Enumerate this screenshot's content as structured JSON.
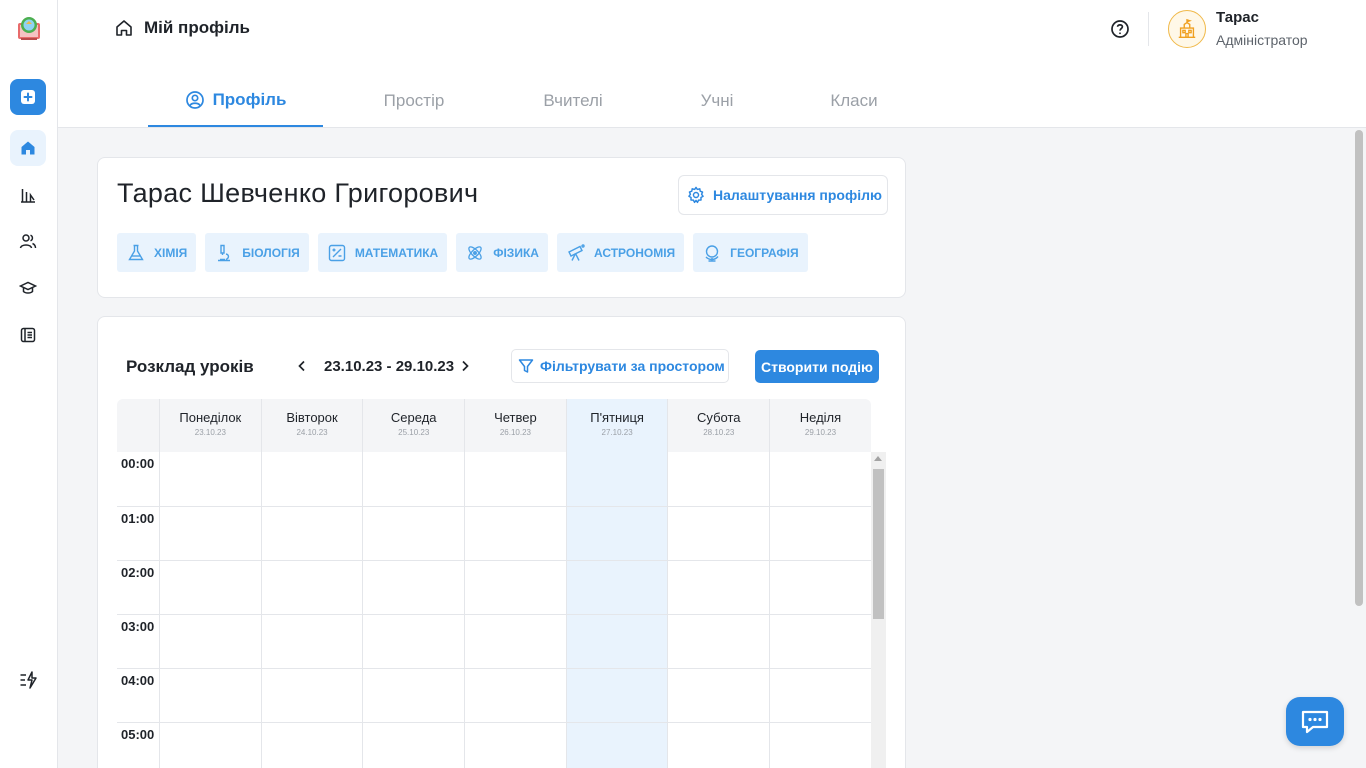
{
  "sidebar": {
    "logo": "school-logo",
    "items": [
      {
        "name": "add-icon"
      },
      {
        "name": "home-icon"
      },
      {
        "name": "statistics-icon"
      },
      {
        "name": "users-icon"
      },
      {
        "name": "graduation-cap-icon"
      },
      {
        "name": "journal-icon"
      }
    ],
    "bottom_icon": "flash-list-icon"
  },
  "header": {
    "title": "Мій профіль",
    "user_name": "Тарас",
    "user_role": "Адміністратор"
  },
  "tabs": [
    {
      "label": "Профіль",
      "active": true
    },
    {
      "label": "Простір",
      "active": false
    },
    {
      "label": "Вчителі",
      "active": false
    },
    {
      "label": "Учні",
      "active": false
    },
    {
      "label": "Класи",
      "active": false
    }
  ],
  "profile": {
    "full_name": "Тарас Шевченко Григорович",
    "settings_label": "Налаштування профілю",
    "subjects": [
      "Хімія",
      "Біологія",
      "Математика",
      "Фізика",
      "Астрономія",
      "Географія"
    ]
  },
  "schedule": {
    "title": "Розклад уроків",
    "date_range": "23.10.23 - 29.10.23",
    "filter_label": "Фільтрувати за простором",
    "create_label": "Створити подію",
    "days": [
      {
        "name": "Понеділок",
        "date": "23.10.23"
      },
      {
        "name": "Вівторок",
        "date": "24.10.23"
      },
      {
        "name": "Середа",
        "date": "25.10.23"
      },
      {
        "name": "Четвер",
        "date": "26.10.23"
      },
      {
        "name": "П'ятниця",
        "date": "27.10.23",
        "today": true
      },
      {
        "name": "Субота",
        "date": "28.10.23"
      },
      {
        "name": "Неділя",
        "date": "29.10.23"
      }
    ],
    "times": [
      "00:00",
      "01:00",
      "02:00",
      "03:00",
      "04:00",
      "05:00"
    ]
  },
  "colors": {
    "accent": "#2d88e0",
    "accent_light": "#e9f3fd",
    "chip_text": "#4aa0e6"
  }
}
